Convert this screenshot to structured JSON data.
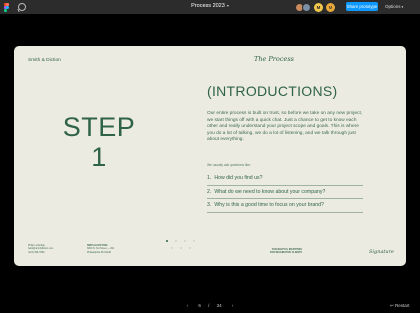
{
  "toolbar": {
    "document_title": "Process 2023",
    "collaborator_count": "M",
    "collaborator_initial": "M",
    "share_label": "Share prototype",
    "options_label": "Options",
    "colors": {
      "bar": "#2c2c2c",
      "share_button": "#0d99ff"
    }
  },
  "slide": {
    "brand": "Smith & Diction",
    "section_script": "The Process",
    "step_word": "STEP",
    "step_number": "1",
    "heading": "(INTRODUCTIONS)",
    "body": "Our entire process is built on trust, so before we take on any new project, we start things off with a quick chat. Just a chance to get to know each other and really understand your project scope and goals. This is where you do a lot of talking, we do a lot of listening, and we talk through just about everything.",
    "questions_label": "We usually ask questions like:",
    "questions": [
      {
        "num": "1.",
        "text": "How did you find us?"
      },
      {
        "num": "2.",
        "text": "What do we need to know about your company?"
      },
      {
        "num": "3.",
        "text": "Why is this a good time to focus on your brand?"
      }
    ],
    "footer_contact": [
      "Philip Lockridge",
      "hello@smithdiction.com",
      "(123) 456-7890"
    ],
    "footer_address": [
      "SMITH & DICTION",
      "3000 N. 3rd Street — 201",
      "Philadelphia PA 19128"
    ],
    "footer_tagline": [
      "THOUGHTFUL IDENTITIES",
      "FOR IMAGINATIVE CLIENTS"
    ],
    "signature": "Signature",
    "pagination_dots": 7,
    "active_dot": 0,
    "colors": {
      "background": "#ecebe2",
      "accent": "#2f6346"
    }
  },
  "pager": {
    "prev": "‹",
    "current": "6",
    "separator": "/",
    "total": "34",
    "next": "›",
    "restart_label": "Restart"
  }
}
